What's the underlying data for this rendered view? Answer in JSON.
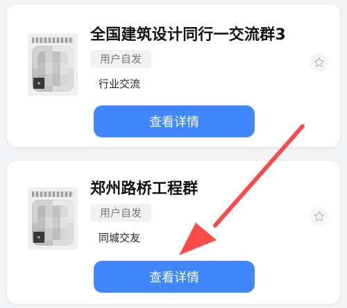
{
  "cards": [
    {
      "title": "全国建筑设计同行一交流群3",
      "tag": "用户自发",
      "desc": "行业交流",
      "button_label": "查看详情",
      "star_icon": "star-outline-icon"
    },
    {
      "title": "郑州路桥工程群",
      "tag": "用户自发",
      "desc": "同城交友",
      "button_label": "查看详情",
      "star_icon": "star-outline-icon"
    }
  ],
  "overlay": {
    "arrow_color": "#ff4a4a"
  }
}
